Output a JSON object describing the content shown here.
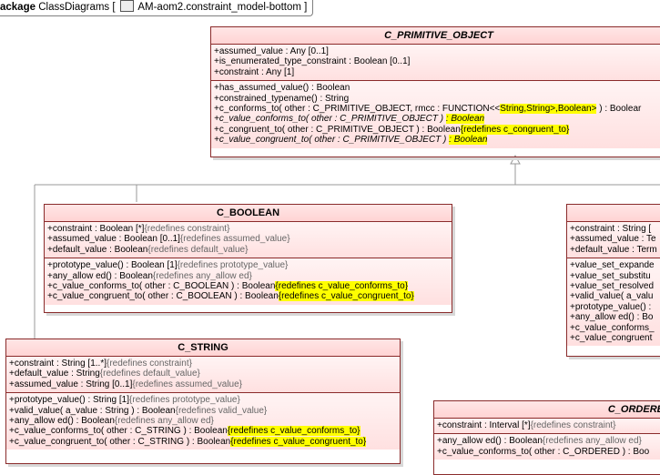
{
  "package_tab": {
    "keyword": "ackage",
    "name": "ClassDiagrams [",
    "diagram_name": "AM-aom2.constraint_model-bottom ]"
  },
  "classes": {
    "c_primitive_object": {
      "title": "C_PRIMITIVE_OBJECT",
      "attributes": [
        "+assumed_value : Any [0..1]",
        "+is_enumerated_type_constraint : Boolean [0..1]",
        "+constraint : Any [1]"
      ],
      "operations": [
        {
          "text": "+has_assumed_value() : Boolean",
          "italic": false
        },
        {
          "text": "+constrained_typename() : String",
          "italic": false
        },
        {
          "text": "+c_conforms_to( other : C_PRIMITIVE_OBJECT, rmcc : FUNCTION<<",
          "hl": "String,String>,Boolean>",
          "tail": " ) : Boolear",
          "italic": false
        },
        {
          "text": "+c_value_conforms_to( other : C_PRIMITIVE_OBJECT ) ",
          "hl": ": Boolean",
          "italic": true
        },
        {
          "text": "+c_congruent_to( other : C_PRIMITIVE_OBJECT ) : Boolean",
          "hl": "{redefines c_congruent_to}",
          "italic": false
        },
        {
          "text": "+c_value_congruent_to( other : C_PRIMITIVE_OBJECT ) ",
          "hl": ": Boolean",
          "italic": true
        }
      ]
    },
    "c_boolean": {
      "title": "C_BOOLEAN",
      "attributes": [
        {
          "text": "+constraint : Boolean [*]",
          "gray": "{redefines constraint}"
        },
        {
          "text": "+assumed_value : Boolean [0..1]",
          "gray": "{redefines assumed_value}"
        },
        {
          "text": "+default_value : Boolean",
          "gray": "{redefines default_value}"
        }
      ],
      "operations": [
        {
          "text": "+prototype_value() : Boolean [1]",
          "gray": "{redefines prototype_value}"
        },
        {
          "text": "+any_allow ed() : Boolean",
          "gray": "{redefines any_allow ed}"
        },
        {
          "text": "+c_value_conforms_to( other : C_BOOLEAN ) : Boolean",
          "hl": "{redefines c_value_conforms_to}"
        },
        {
          "text": "+c_value_congruent_to( other : C_BOOLEAN ) : Boolean",
          "hl": "{redefines c_value_congruent_to}"
        }
      ]
    },
    "c_string": {
      "title": "C_STRING",
      "attributes": [
        {
          "text": "+constraint : String [1..*]",
          "gray": "{redefines constraint}"
        },
        {
          "text": "+default_value : String",
          "gray": "{redefines default_value}"
        },
        {
          "text": "+assumed_value : String [0..1]",
          "gray": "{redefines assumed_value}"
        }
      ],
      "operations": [
        {
          "text": "+prototype_value() : String [1]",
          "gray": "{redefines prototype_value}"
        },
        {
          "text": "+valid_value( a_value : String ) : Boolean",
          "gray": "{redefines valid_value}"
        },
        {
          "text": "+any_allow ed() : Boolean",
          "gray": "{redefines any_allow ed}"
        },
        {
          "text": "+c_value_conforms_to( other : C_STRING ) : Boolean",
          "hl": "{redefines c_value_conforms_to}"
        },
        {
          "text": "+c_value_congruent_to( other : C_STRING ) : Boolean",
          "hl": "{redefines c_value_congruent_to}"
        }
      ]
    },
    "c_terminology": {
      "title": "",
      "attributes": [
        "+constraint : String [",
        "+assumed_value : Te",
        "+default_value : Term"
      ],
      "operations": [
        "+value_set_expande",
        "+value_set_substitu",
        "+value_set_resolved",
        "+valid_value( a_valu",
        "+prototype_value() :",
        "+any_allow ed() : Bo",
        "+c_value_conforms_",
        "+c_value_congruent"
      ]
    },
    "c_ordered": {
      "title": "C_ORDERE",
      "attributes": [
        {
          "text": "+constraint : Interval [*]",
          "gray": "{redefines constraint}"
        }
      ],
      "operations": [
        {
          "text": "+any_allow ed() : Boolean",
          "gray": "{redefines any_allow ed}"
        },
        {
          "text": "+c_value_conforms_to( other : C_ORDERED ) : Boo",
          "gray": ""
        }
      ]
    }
  }
}
